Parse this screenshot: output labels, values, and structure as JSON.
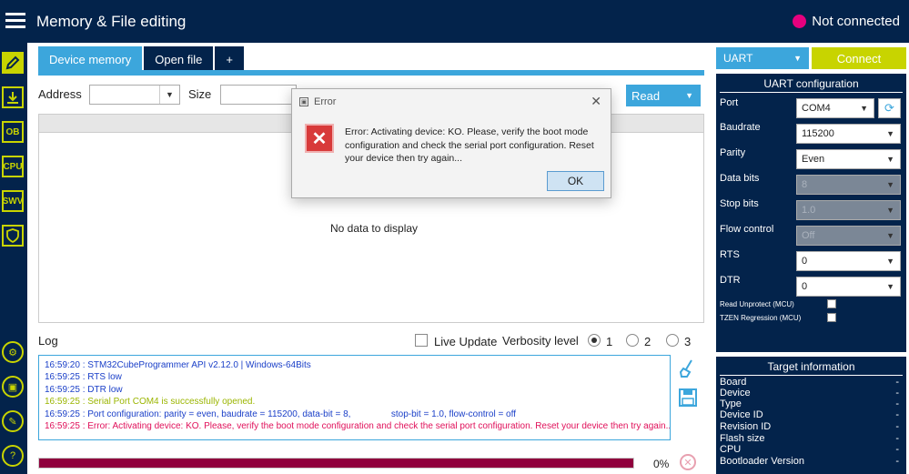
{
  "header": {
    "title": "Memory & File editing",
    "connection_status": "Not connected",
    "status_color": "#e6007e"
  },
  "left_nav": {
    "items": [
      {
        "name": "edit-memory",
        "label": "",
        "active": true
      },
      {
        "name": "download",
        "label": "",
        "active": false
      },
      {
        "name": "option-bytes",
        "label": "OB",
        "active": false
      },
      {
        "name": "cpu",
        "label": "CPU",
        "active": false
      },
      {
        "name": "swv",
        "label": "SWV",
        "active": false
      },
      {
        "name": "security",
        "label": "",
        "active": false
      }
    ]
  },
  "main": {
    "tabs": [
      {
        "label": "Device memory"
      },
      {
        "label": "Open file"
      },
      {
        "label": "+"
      }
    ],
    "address_label": "Address",
    "size_label": "Size",
    "read_button": "Read",
    "no_data": "No data to display"
  },
  "log": {
    "label": "Log",
    "live_update_label": "Live Update",
    "verbosity_label": "Verbosity level",
    "levels": [
      "1",
      "2",
      "3"
    ],
    "selected_level": "1",
    "lines": [
      {
        "text": "16:59:20 : STM32CubeProgrammer API v2.12.0 | Windows-64Bits",
        "color": "#1a3fc8"
      },
      {
        "text": "16:59:25 : RTS low",
        "color": "#1a3fc8"
      },
      {
        "text": "16:59:25 : DTR low",
        "color": "#1a3fc8"
      },
      {
        "text": "16:59:25 : Serial Port COM4 is successfully opened.",
        "color": "#9bb500"
      },
      {
        "text": "16:59:25 : Port configuration: parity = even, baudrate = 115200, data-bit = 8,                stop-bit = 1.0, flow-control = off",
        "color": "#1a3fc8"
      },
      {
        "text": "16:59:25 : Error: Activating device: KO. Please, verify the boot mode configuration and check the serial port configuration. Reset your device then try again...",
        "color": "#e0105a"
      }
    ],
    "progress_percent": "0%",
    "progress_fraction": 1.0
  },
  "right": {
    "interface": "UART",
    "connect_button": "Connect",
    "uart_title": "UART configuration",
    "fields": {
      "port": {
        "label": "Port",
        "value": "COM4"
      },
      "baudrate": {
        "label": "Baudrate",
        "value": "115200"
      },
      "parity": {
        "label": "Parity",
        "value": "Even"
      },
      "data_bits": {
        "label": "Data bits",
        "value": "8"
      },
      "stop_bits": {
        "label": "Stop bits",
        "value": "1.0"
      },
      "flow_control": {
        "label": "Flow control",
        "value": "Off"
      },
      "rts": {
        "label": "RTS",
        "value": "0"
      },
      "dtr": {
        "label": "DTR",
        "value": "0"
      }
    },
    "read_unprotect_label": "Read Unprotect (MCU)",
    "tzen_label": "TZEN Regression (MCU)",
    "target_title": "Target information",
    "target_rows": [
      {
        "label": "Board",
        "value": "-"
      },
      {
        "label": "Device",
        "value": "-"
      },
      {
        "label": "Type",
        "value": "-"
      },
      {
        "label": "Device ID",
        "value": "-"
      },
      {
        "label": "Revision ID",
        "value": "-"
      },
      {
        "label": "Flash size",
        "value": "-"
      },
      {
        "label": "CPU",
        "value": "-"
      },
      {
        "label": "Bootloader Version",
        "value": "-"
      }
    ]
  },
  "dialog": {
    "title": "Error",
    "message": "Error: Activating device: KO. Please, verify the boot mode configuration and check the serial port configuration. Reset your device then try again...",
    "ok_label": "OK"
  }
}
